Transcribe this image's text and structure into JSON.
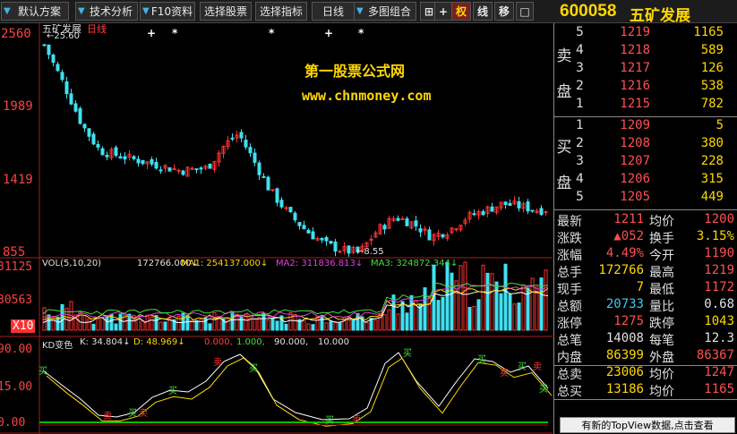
{
  "toolbar": {
    "buttons": [
      "默认方案",
      "技术分析",
      "F10资料",
      "选择股票",
      "选择指标",
      "日线",
      "多图组合"
    ],
    "icons": [
      "⊞",
      "+",
      "权",
      "线",
      "移",
      "□"
    ]
  },
  "stock": {
    "code": "600058",
    "name": "五矿发展"
  },
  "kline": {
    "title": "五矿发展",
    "period": "日线",
    "high_label": "←25.60",
    "low_label": "←8.55",
    "y_ticks": [
      "2560",
      "1989",
      "1419",
      "855"
    ],
    "markers": [
      "+",
      "*",
      "*",
      "+",
      "*"
    ]
  },
  "watermark": {
    "line1": "第一股票公式网",
    "line2": "www.chnmoney.com"
  },
  "volume": {
    "label": "VOL(5,10,20)",
    "vol": "172766.000↓",
    "ma1": "MA1: 254137.000↓",
    "ma2": "MA2: 311836.813↓",
    "ma3": "MA3: 324872.344↓",
    "y_ticks": [
      "31125",
      "30563",
      "X10"
    ]
  },
  "kd": {
    "label": "KD变色",
    "k": "K: 34.804↓",
    "d": "D: 48.969↓",
    "v0": "0.000,",
    "v1": "1.000,",
    "v90": "90.000,",
    "v10": "10.000",
    "y_ticks": [
      "90.00",
      "15.00",
      "0.00"
    ],
    "signal_sell": "卖",
    "signal_buy": "买"
  },
  "order_book": {
    "sell_label": [
      "卖",
      "盘"
    ],
    "buy_label": [
      "买",
      "盘"
    ],
    "sell": [
      {
        "n": "5",
        "p": "1219",
        "v": "1165"
      },
      {
        "n": "4",
        "p": "1218",
        "v": "589"
      },
      {
        "n": "3",
        "p": "1217",
        "v": "126"
      },
      {
        "n": "2",
        "p": "1216",
        "v": "538"
      },
      {
        "n": "1",
        "p": "1215",
        "v": "782"
      }
    ],
    "buy": [
      {
        "n": "1",
        "p": "1209",
        "v": "5"
      },
      {
        "n": "2",
        "p": "1208",
        "v": "380"
      },
      {
        "n": "3",
        "p": "1207",
        "v": "228"
      },
      {
        "n": "4",
        "p": "1206",
        "v": "315"
      },
      {
        "n": "5",
        "p": "1205",
        "v": "449"
      }
    ]
  },
  "stats": [
    {
      "k1": "最新",
      "v1": "1211",
      "c1": "#ff5050",
      "k2": "均价",
      "v2": "1200",
      "c2": "#ff5050"
    },
    {
      "k1": "涨跌",
      "v1": "▲052",
      "c1": "#ff5050",
      "k2": "换手",
      "v2": "3.15%",
      "c2": "#ffd800"
    },
    {
      "k1": "涨幅",
      "v1": "4.49%",
      "c1": "#ff5050",
      "k2": "今开",
      "v2": "1190",
      "c2": "#ff5050"
    },
    {
      "k1": "总手",
      "v1": "172766",
      "c1": "#ffd800",
      "k2": "最高",
      "v2": "1219",
      "c2": "#ff5050"
    },
    {
      "k1": "现手",
      "v1": "7",
      "c1": "#ffd800",
      "k2": "最低",
      "v2": "1172",
      "c2": "#ff5050"
    },
    {
      "k1": "总额",
      "v1": "20733",
      "c1": "#3fc6f0",
      "k2": "量比",
      "v2": "0.68",
      "c2": "#e0e0e0"
    },
    {
      "k1": "涨停",
      "v1": "1275",
      "c1": "#ff5050",
      "k2": "跌停",
      "v2": "1043",
      "c2": "#ffd800"
    },
    {
      "k1": "总笔",
      "v1": "14008",
      "c1": "#e0e0e0",
      "k2": "每笔",
      "v2": "12.3",
      "c2": "#e0e0e0"
    },
    {
      "k1": "内盘",
      "v1": "86399",
      "c1": "#ffd800",
      "k2": "外盘",
      "v2": "86367",
      "c2": "#ff5050"
    },
    {
      "k1": "总卖",
      "v1": "23006",
      "c1": "#ffd800",
      "k2": "均价",
      "v2": "1247",
      "c2": "#ff5050"
    },
    {
      "k1": "总买",
      "v1": "13186",
      "c1": "#ffd800",
      "k2": "均价",
      "v2": "1165",
      "c2": "#ff5050"
    }
  ],
  "topview": "有新的TopView数据,点击查看"
}
